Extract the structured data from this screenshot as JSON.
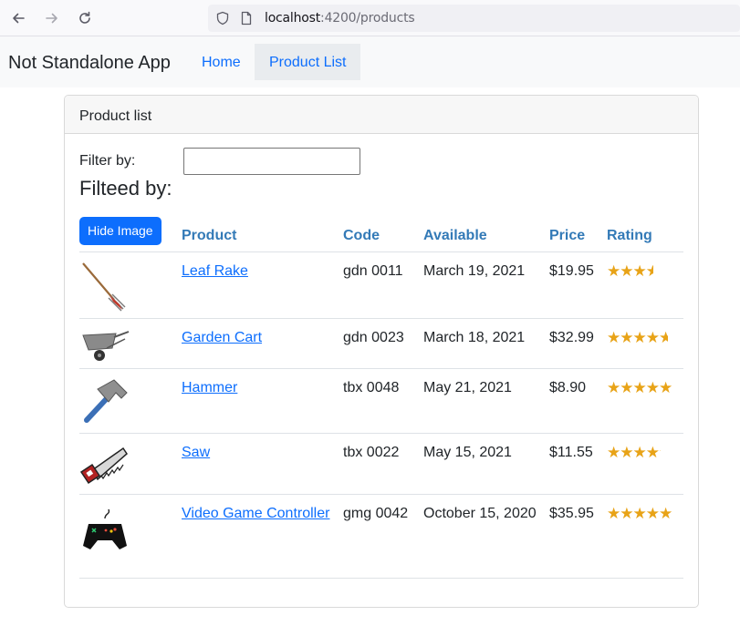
{
  "browser": {
    "url_host": "localhost",
    "url_path": ":4200/products",
    "back_icon": "arrow-left-icon",
    "forward_icon": "arrow-right-icon",
    "reload_icon": "reload-icon"
  },
  "navbar": {
    "brand": "Not Standalone App",
    "links": [
      {
        "label": "Home"
      },
      {
        "label": "Product List"
      }
    ]
  },
  "card": {
    "title": "Product list",
    "filter_label": "Filter by:",
    "filter_value": "",
    "filtered_text": "Filteed by:"
  },
  "table": {
    "hide_image_label": "Hide Image",
    "headers": [
      "Product",
      "Code",
      "Available",
      "Price",
      "Rating"
    ],
    "rows": [
      {
        "image": "leaf-rake-image",
        "name": "Leaf Rake",
        "code": "gdn 0011",
        "available": "March 19, 2021",
        "price": "$19.95",
        "rating": 3.2
      },
      {
        "image": "garden-cart-image",
        "name": "Garden Cart",
        "code": "gdn 0023",
        "available": "March 18, 2021",
        "price": "$32.99",
        "rating": 4.2
      },
      {
        "image": "hammer-image",
        "name": "Hammer",
        "code": "tbx 0048",
        "available": "May 21, 2021",
        "price": "$8.90",
        "rating": 4.8
      },
      {
        "image": "saw-image",
        "name": "Saw",
        "code": "tbx 0022",
        "available": "May 15, 2021",
        "price": "$11.55",
        "rating": 3.7
      },
      {
        "image": "video-game-controller-image",
        "name": "Video Game Controller",
        "code": "gmg 0042",
        "available": "October 15, 2020",
        "price": "$35.95",
        "rating": 4.6
      }
    ]
  },
  "colors": {
    "link": "#0d6efd",
    "header_text": "#337ab7",
    "star": "#e8a317",
    "button": "#0d6efd"
  }
}
